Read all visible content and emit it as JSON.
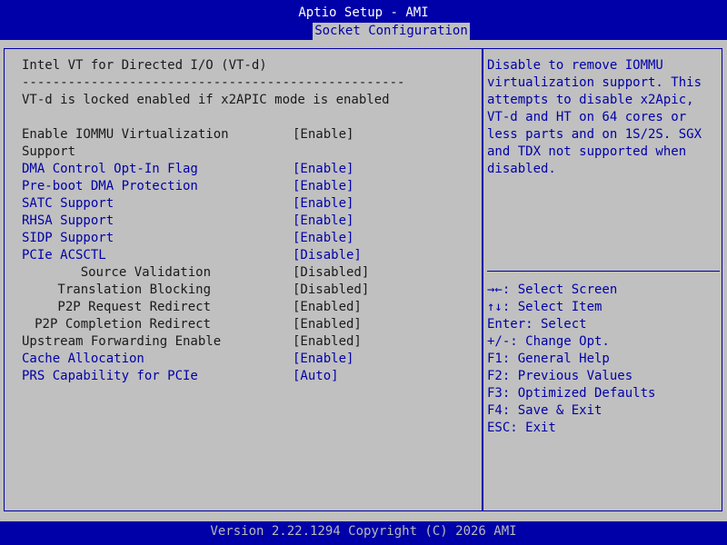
{
  "header": {
    "app_title": "Aptio Setup - AMI",
    "active_tab": "Socket Configuration"
  },
  "main": {
    "section_title": "Intel VT for Directed I/O (VT-d)",
    "separator": "--------------------------------------------------",
    "note": "VT-d is locked enabled if x2APIC mode is enabled",
    "items": [
      {
        "label": "Enable IOMMU Virtualization",
        "label2": "Support",
        "value": "[Enable]"
      },
      {
        "label": "DMA Control Opt-In Flag",
        "value": "[Enable]"
      },
      {
        "label": "Pre-boot DMA Protection",
        "value": "[Enable]"
      },
      {
        "label": "SATC Support",
        "value": "[Enable]"
      },
      {
        "label": "RHSA Support",
        "value": "[Enable]"
      },
      {
        "label": "SIDP Support",
        "value": "[Enable]"
      },
      {
        "label": "PCIe ACSCTL",
        "value": "[Disable]"
      },
      {
        "label": "Source Validation",
        "value": "[Disabled]"
      },
      {
        "label": "Translation Blocking",
        "value": "[Disabled]"
      },
      {
        "label": "P2P Request Redirect",
        "value": "[Enabled]"
      },
      {
        "label": "P2P Completion Redirect",
        "value": "[Enabled]"
      },
      {
        "label": "Upstream Forwarding Enable",
        "value": "[Enabled]"
      },
      {
        "label": "Cache Allocation",
        "value": "[Enable]"
      },
      {
        "label": "PRS Capability for PCIe",
        "value": "[Auto]"
      }
    ]
  },
  "help": {
    "description": [
      "Disable to remove IOMMU",
      "virtualization support. This",
      "attempts to disable x2Apic,",
      "VT-d and HT on 64 cores or",
      "less parts and on 1S/2S. SGX",
      "and TDX not supported when",
      "disabled."
    ],
    "keys": [
      "→←: Select Screen",
      "↑↓: Select Item",
      "Enter: Select",
      "+/-: Change Opt.",
      "F1: General Help",
      "F2: Previous Values",
      "F3: Optimized Defaults",
      "F4: Save & Exit",
      "ESC: Exit"
    ]
  },
  "footer": {
    "version": "Version 2.22.1294 Copyright (C) 2026 AMI"
  },
  "colors": {
    "background": "#c0c0c0",
    "accent_blue": "#0000a8",
    "text_dark": "#1a1a1a",
    "footer_text": "#b8b8b8"
  }
}
